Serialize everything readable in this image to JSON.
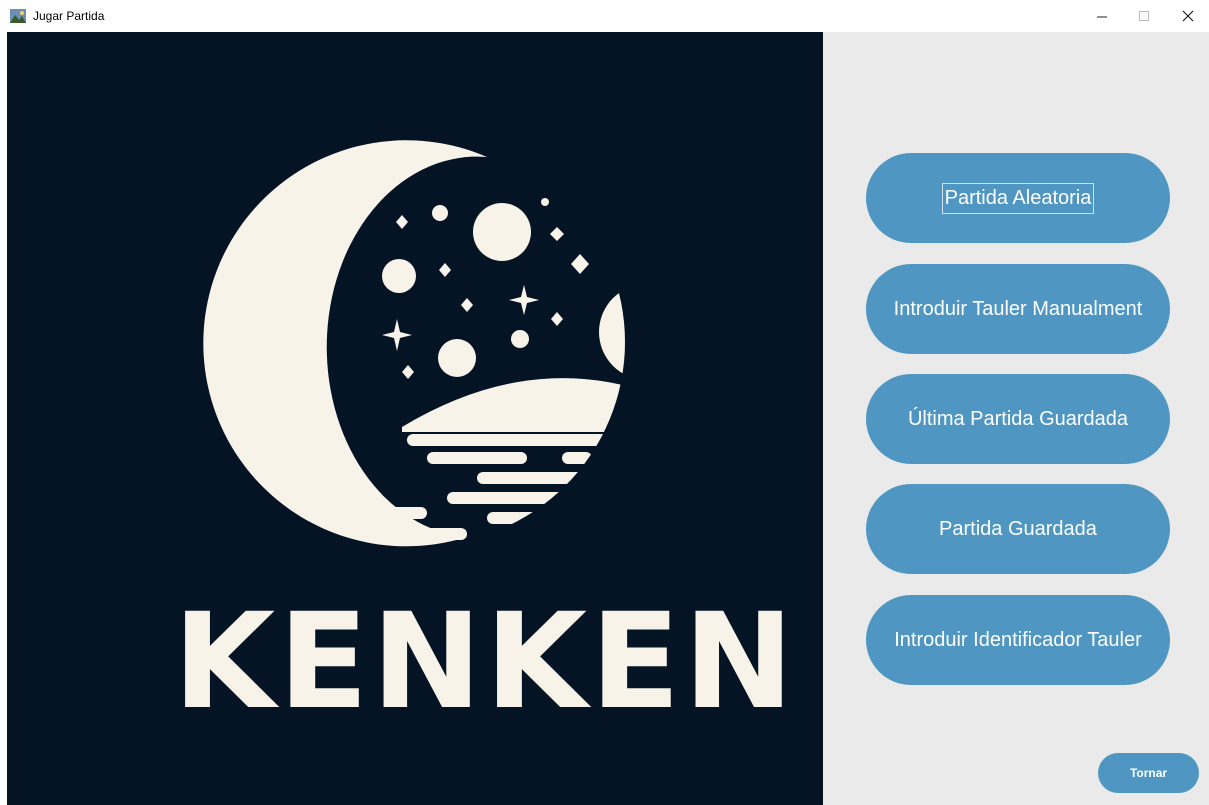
{
  "window": {
    "title": "Jugar Partida",
    "controls": [
      "minimize-icon",
      "maximize-icon",
      "close-icon"
    ]
  },
  "logo": {
    "wordmark": "KENKEN",
    "background_color": "#041425",
    "foreground_color": "#f7f3e9"
  },
  "menu": {
    "buttons": [
      {
        "label": "Partida Aleatoria",
        "focused": true
      },
      {
        "label": "Introduir Tauler Manualment"
      },
      {
        "label": "Última Partida Guardada"
      },
      {
        "label": "Partida Guardada"
      },
      {
        "label": "Introduir Identificador Tauler"
      }
    ],
    "back_label": "Tornar",
    "accent_color": "#4f97c2",
    "panel_color": "#eaeaea"
  }
}
